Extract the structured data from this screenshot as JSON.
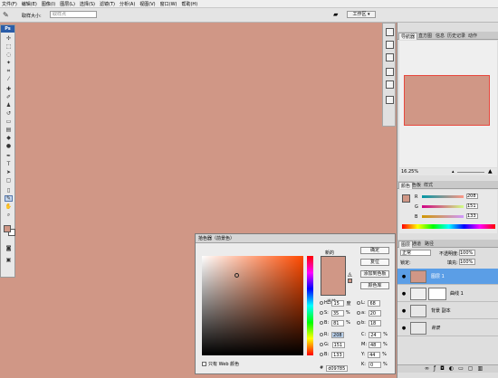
{
  "menu": [
    "文件(F)",
    "编辑(E)",
    "图像(I)",
    "图层(L)",
    "选择(S)",
    "滤镜(T)",
    "分析(A)",
    "视图(V)",
    "窗口(W)",
    "帮助(H)"
  ],
  "options": {
    "size_label": "取样大小:",
    "size_value": "取样点",
    "workspace": "工作区 ▾"
  },
  "toolbox": {
    "logo": "Ps",
    "fg_color": "#d09786",
    "bg_color": "#ffffff"
  },
  "navigator": {
    "tabs": [
      "导航器",
      "直方图",
      "信息",
      "历史记录",
      "动作"
    ],
    "zoom": "16.25%"
  },
  "color_panel": {
    "tabs": [
      "颜色",
      "色板",
      "样式"
    ],
    "r": "208",
    "g": "151",
    "b": "133",
    "swatch": "#d09786"
  },
  "layers_panel": {
    "tabs": [
      "图层",
      "通道",
      "路径"
    ],
    "blend": "正常",
    "opacity_label": "不透明度:",
    "opacity": "100%",
    "lock_label": "锁定:",
    "fill_label": "填充:",
    "fill": "100%",
    "layers": [
      {
        "name": "图层 1",
        "selected": true,
        "thumb": "#d09786"
      },
      {
        "name": "曲线 1",
        "selected": false,
        "thumb": "#ffffff"
      },
      {
        "name": "背景 副本",
        "selected": false,
        "thumb": "#e8e8e8"
      },
      {
        "name": "背景",
        "selected": false,
        "thumb": "#e8e8e8"
      }
    ]
  },
  "picker": {
    "title": "拾色器（前景色）",
    "new_label": "新的",
    "current_label": "当前",
    "new_color": "#d09786",
    "current_color": "#d09786",
    "ok": "确定",
    "reset": "复位",
    "add_swatch": "添加到色板",
    "libraries": "颜色库",
    "web_only": "只有 Web 颜色",
    "h": "15",
    "h_unit": "度",
    "s": "35",
    "b": "81",
    "r": "208",
    "g": "151",
    "bv": "133",
    "l": "68",
    "a": "20",
    "lab_b": "18",
    "c": "24",
    "m": "48",
    "y": "44",
    "k": "0",
    "pct": "%",
    "hex_label": "#",
    "hex": "d09785"
  }
}
